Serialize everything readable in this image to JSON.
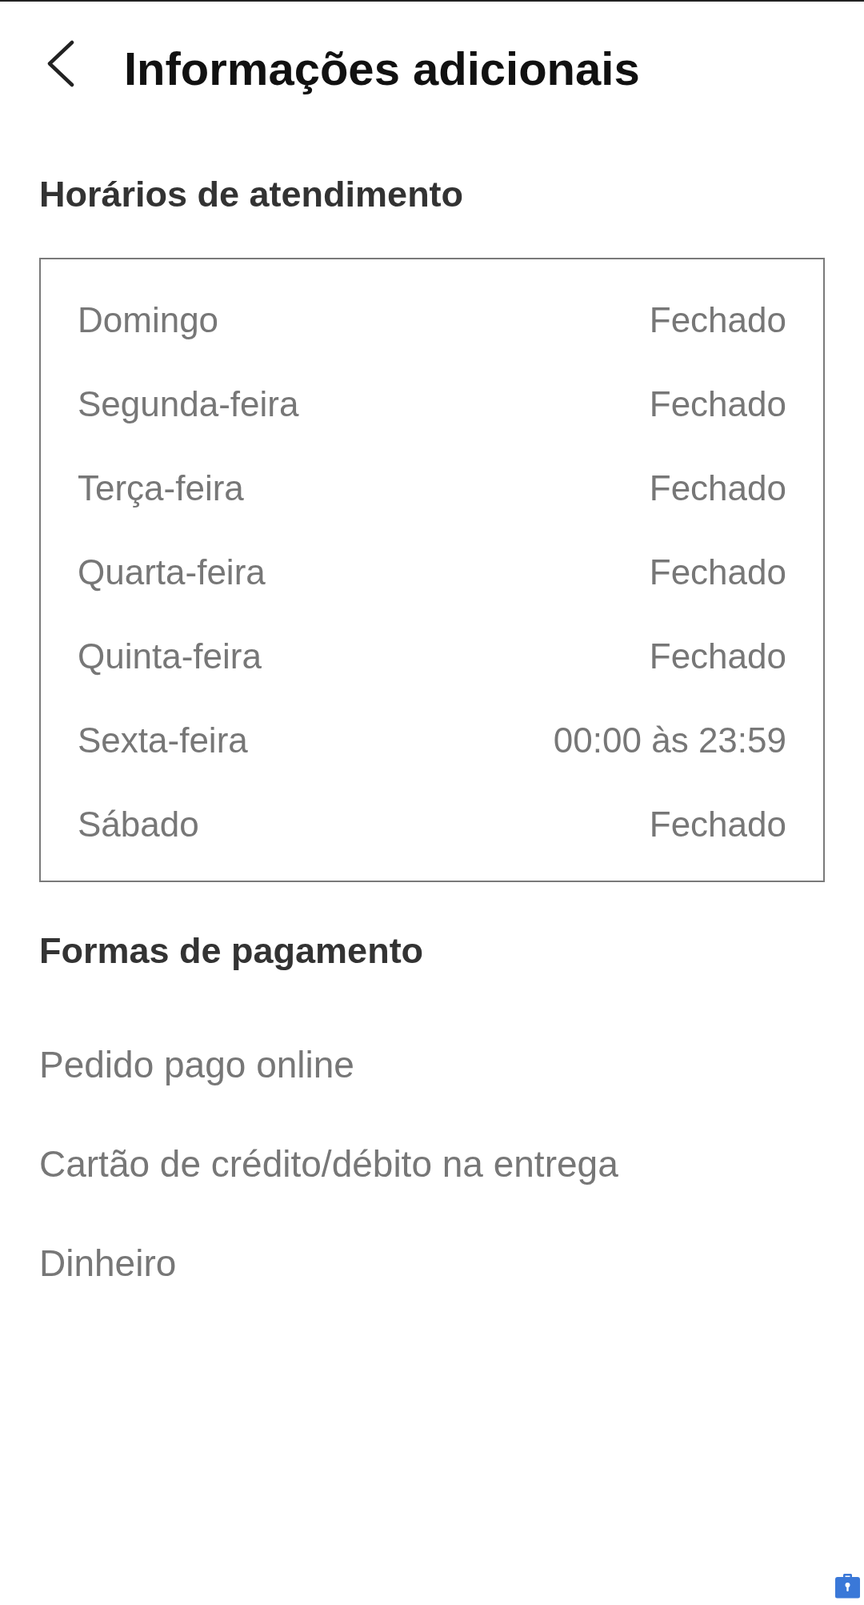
{
  "header": {
    "title": "Informações adicionais"
  },
  "opening_hours": {
    "title": "Horários de atendimento",
    "rows": [
      {
        "day": "Domingo",
        "hours": "Fechado"
      },
      {
        "day": "Segunda-feira",
        "hours": "Fechado"
      },
      {
        "day": "Terça-feira",
        "hours": "Fechado"
      },
      {
        "day": "Quarta-feira",
        "hours": "Fechado"
      },
      {
        "day": "Quinta-feira",
        "hours": "Fechado"
      },
      {
        "day": "Sexta-feira",
        "hours": "00:00 às 23:59"
      },
      {
        "day": "Sábado",
        "hours": "Fechado"
      }
    ]
  },
  "payment_methods": {
    "title": "Formas de pagamento",
    "items": [
      "Pedido pago online",
      "Cartão de crédito/débito na entrega",
      "Dinheiro"
    ]
  }
}
